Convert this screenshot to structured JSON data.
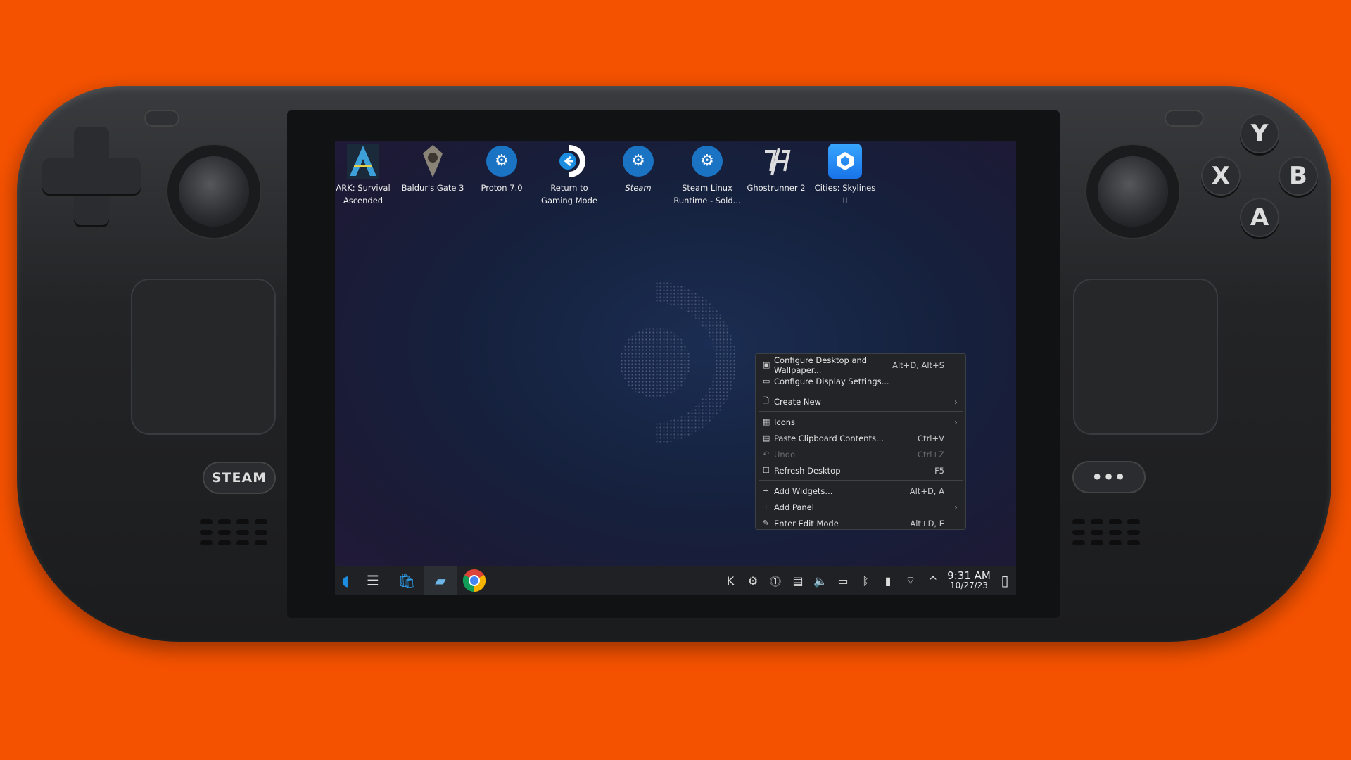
{
  "device": {
    "steam_button": "STEAM",
    "menu_button": "•••",
    "face_buttons": {
      "y": "Y",
      "x": "X",
      "b": "B",
      "a": "A"
    }
  },
  "desktop_icons": [
    {
      "label": "ARK: Survival Ascended",
      "icon": "ark-icon"
    },
    {
      "label": "Baldur's Gate 3",
      "icon": "baldurs-gate-icon"
    },
    {
      "label": "Proton 7.0",
      "icon": "steam-icon"
    },
    {
      "label": "Return to Gaming Mode",
      "icon": "return-gaming-mode-icon"
    },
    {
      "label": "Steam",
      "icon": "steam-icon"
    },
    {
      "label": "Steam Linux Runtime - Sold...",
      "icon": "steam-icon"
    },
    {
      "label": "Ghostrunner 2",
      "icon": "ghostrunner-icon"
    },
    {
      "label": "Cities: Skylines II",
      "icon": "cities-skylines-icon"
    }
  ],
  "context_menu": {
    "items": [
      {
        "label": "Configure Desktop and Wallpaper...",
        "shortcut": "Alt+D, Alt+S",
        "icon": "▣"
      },
      {
        "label": "Configure Display Settings...",
        "shortcut": "",
        "icon": "▭"
      },
      {
        "label": "Create New",
        "shortcut": "",
        "icon": "🗋",
        "submenu": true
      },
      {
        "label": "Icons",
        "shortcut": "",
        "icon": "▦",
        "submenu": true
      },
      {
        "label": "Paste Clipboard Contents...",
        "shortcut": "Ctrl+V",
        "icon": "▤"
      },
      {
        "label": "Undo",
        "shortcut": "Ctrl+Z",
        "icon": "↶",
        "disabled": true
      },
      {
        "label": "Refresh Desktop",
        "shortcut": "F5",
        "icon": "☐"
      },
      {
        "label": "Add Widgets...",
        "shortcut": "Alt+D, A",
        "icon": "+"
      },
      {
        "label": "Add Panel",
        "shortcut": "",
        "icon": "+",
        "submenu": true
      },
      {
        "label": "Enter Edit Mode",
        "shortcut": "Alt+D, E",
        "icon": "✎"
      }
    ]
  },
  "taskbar": {
    "time": "9:31 AM",
    "date": "10/27/23",
    "tray_icons": [
      "kde-connect-icon",
      "steam-tray-icon",
      "update-icon",
      "clipboard-icon",
      "volume-icon",
      "battery-icon",
      "bluetooth-icon",
      "usb-drive-icon",
      "wifi-icon",
      "expand-tray-icon"
    ]
  },
  "colors": {
    "background": "#f55200",
    "accent": "#1b73c4"
  }
}
